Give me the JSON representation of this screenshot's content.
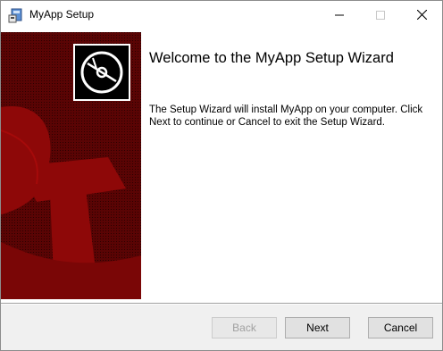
{
  "window": {
    "title": "MyApp Setup",
    "app_icon": "installer-icon"
  },
  "main": {
    "heading": "Welcome to the MyApp Setup Wizard",
    "description": "The Setup Wizard will install MyApp on your computer. Click Next to continue or Cancel to exit the Setup Wizard."
  },
  "banner": {
    "icon": "disc-icon",
    "color": "#7a0606"
  },
  "buttons": {
    "back": "Back",
    "next": "Next",
    "cancel": "Cancel"
  }
}
